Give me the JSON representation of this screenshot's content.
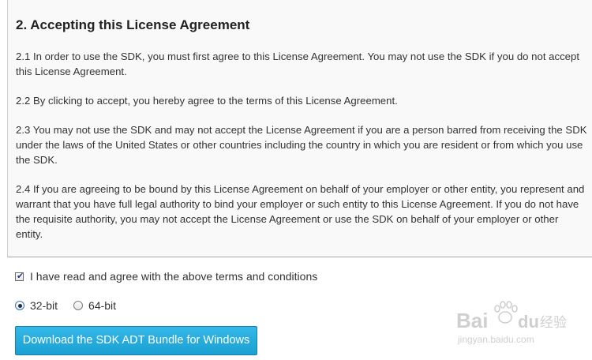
{
  "license": {
    "heading": "2. Accepting this License Agreement",
    "paragraphs": [
      "2.1 In order to use the SDK, you must first agree to this License Agreement. You may not use the SDK if you do not accept this License Agreement.",
      "2.2 By clicking to accept, you hereby agree to the terms of this License Agreement.",
      "2.3 You may not use the SDK and may not accept the License Agreement if you are a person barred from receiving the SDK under the laws of the United States or other countries including the country in which you are resident or from which you use the SDK.",
      "2.4 If you are agreeing to be bound by this License Agreement on behalf of your employer or other entity, you represent and warrant that you have full legal authority to bind your employer or such entity to this License Agreement. If you do not have the requisite authority, you may not accept the License Agreement or use the SDK on behalf of your employer or other entity."
    ]
  },
  "agreement": {
    "checked": true,
    "label": "I have read and agree with the above terms and conditions"
  },
  "architecture": {
    "selected": "32-bit",
    "options": [
      "32-bit",
      "64-bit"
    ]
  },
  "download_button": {
    "label": "Download the SDK ADT Bundle for Windows"
  },
  "watermark": {
    "brand": "Baidu",
    "brand_cn": "经验",
    "site": "jingyan.baidu.com"
  },
  "colors": {
    "panel_bg": "#f9f9f9",
    "button_bg": "#27ace0",
    "text": "#333333",
    "watermark": "#d0d0d0"
  }
}
